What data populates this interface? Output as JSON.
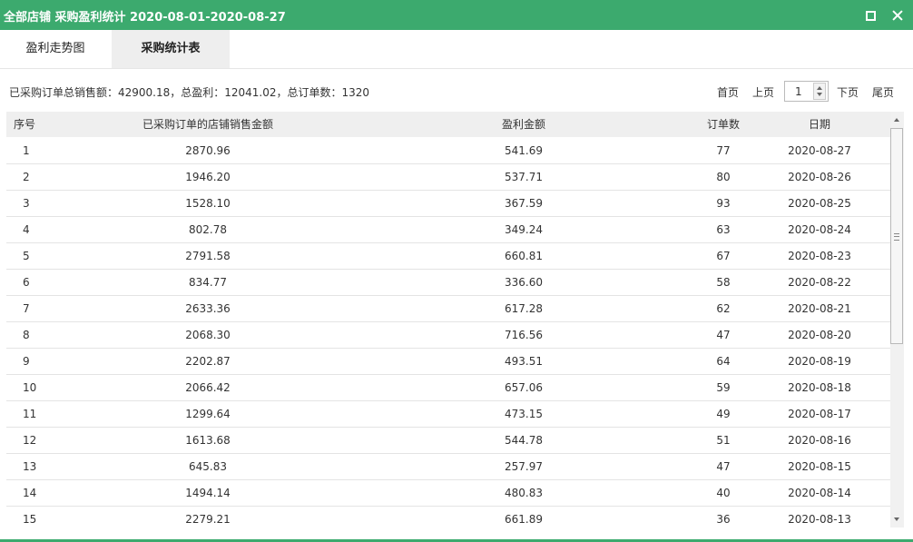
{
  "window": {
    "title": "全部店铺 采购盈利统计 2020-08-01-2020-08-27",
    "maximize_icon": "maximize-icon",
    "close_icon": "close-icon",
    "accent_color": "#3caa6e"
  },
  "tabs": [
    {
      "label": "盈利走势图",
      "active": false
    },
    {
      "label": "采购统计表",
      "active": true
    }
  ],
  "summary": "已采购订单总销售额：42900.18，总盈利：12041.02，总订单数：1320",
  "pager": {
    "first": "首页",
    "prev": "上页",
    "page": "1",
    "next": "下页",
    "last": "尾页"
  },
  "table": {
    "headers": [
      "序号",
      "已采购订单的店铺销售金额",
      "盈利金额",
      "订单数",
      "日期"
    ],
    "rows": [
      [
        "1",
        "2870.96",
        "541.69",
        "77",
        "2020-08-27"
      ],
      [
        "2",
        "1946.20",
        "537.71",
        "80",
        "2020-08-26"
      ],
      [
        "3",
        "1528.10",
        "367.59",
        "93",
        "2020-08-25"
      ],
      [
        "4",
        "802.78",
        "349.24",
        "63",
        "2020-08-24"
      ],
      [
        "5",
        "2791.58",
        "660.81",
        "67",
        "2020-08-23"
      ],
      [
        "6",
        "834.77",
        "336.60",
        "58",
        "2020-08-22"
      ],
      [
        "7",
        "2633.36",
        "617.28",
        "62",
        "2020-08-21"
      ],
      [
        "8",
        "2068.30",
        "716.56",
        "47",
        "2020-08-20"
      ],
      [
        "9",
        "2202.87",
        "493.51",
        "64",
        "2020-08-19"
      ],
      [
        "10",
        "2066.42",
        "657.06",
        "59",
        "2020-08-18"
      ],
      [
        "11",
        "1299.64",
        "473.15",
        "49",
        "2020-08-17"
      ],
      [
        "12",
        "1613.68",
        "544.78",
        "51",
        "2020-08-16"
      ],
      [
        "13",
        "645.83",
        "257.97",
        "47",
        "2020-08-15"
      ],
      [
        "14",
        "1494.14",
        "480.83",
        "40",
        "2020-08-14"
      ],
      [
        "15",
        "2279.21",
        "661.89",
        "36",
        "2020-08-13"
      ]
    ]
  }
}
